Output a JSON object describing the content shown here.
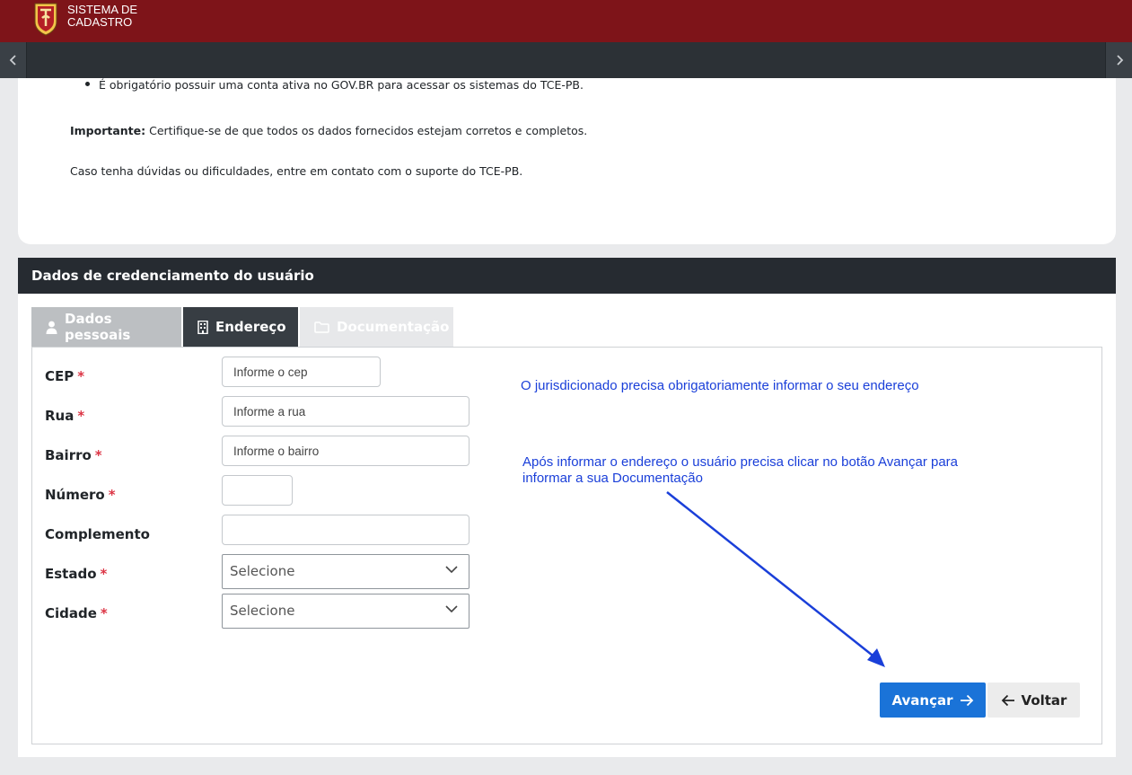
{
  "header": {
    "brand_line1": "SISTEMA DE",
    "brand_line2": "CADASTRO",
    "brand_color": "#7e1419"
  },
  "nav": {
    "prev_icon": "chevron-left-icon",
    "next_icon": "chevron-right-icon"
  },
  "info": {
    "bullet": "É obrigatório possuir uma conta ativa no GOV.BR para acessar os sistemas do TCE-PB.",
    "important_label": "Importante:",
    "important_text": " Certifique-se de que todos os dados fornecidos estejam corretos e completos.",
    "contact_text": "Caso tenha dúvidas ou dificuldades, entre em contato com o suporte do TCE-PB."
  },
  "form": {
    "title": "Dados de credenciamento do usuário",
    "tabs": [
      {
        "label": "Dados pessoais",
        "icon": "user-icon",
        "state": "disabled"
      },
      {
        "label": "Endereço",
        "icon": "building-icon",
        "state": "active"
      },
      {
        "label": "Documentação",
        "icon": "folder-icon",
        "state": "disabled"
      }
    ],
    "fields": {
      "cep": {
        "label": "CEP",
        "required": "*",
        "placeholder": "Informe o cep",
        "value": ""
      },
      "rua": {
        "label": "Rua",
        "required": "*",
        "placeholder": "Informe a rua",
        "value": ""
      },
      "bairro": {
        "label": "Bairro",
        "required": "*",
        "placeholder": "Informe o bairro",
        "value": ""
      },
      "numero": {
        "label": "Número",
        "required": "*",
        "placeholder": "",
        "value": ""
      },
      "complemento": {
        "label": "Complemento",
        "placeholder": "",
        "value": ""
      },
      "estado": {
        "label": "Estado",
        "required": "*",
        "selected": "Selecione"
      },
      "cidade": {
        "label": "Cidade",
        "required": "*",
        "selected": "Selecione"
      }
    },
    "buttons": {
      "next_label": "Avançar",
      "back_label": "Voltar",
      "next_color": "#1a73d8"
    }
  },
  "annotations": {
    "note1": "O jurisdicionado precisa obrigatoriamente informar o seu endereço",
    "note2_line1": "Após informar o endereço o usuário precisa clicar no botão Avançar para",
    "note2_line2": "informar a sua Documentação",
    "color": "#1a3fd9"
  }
}
